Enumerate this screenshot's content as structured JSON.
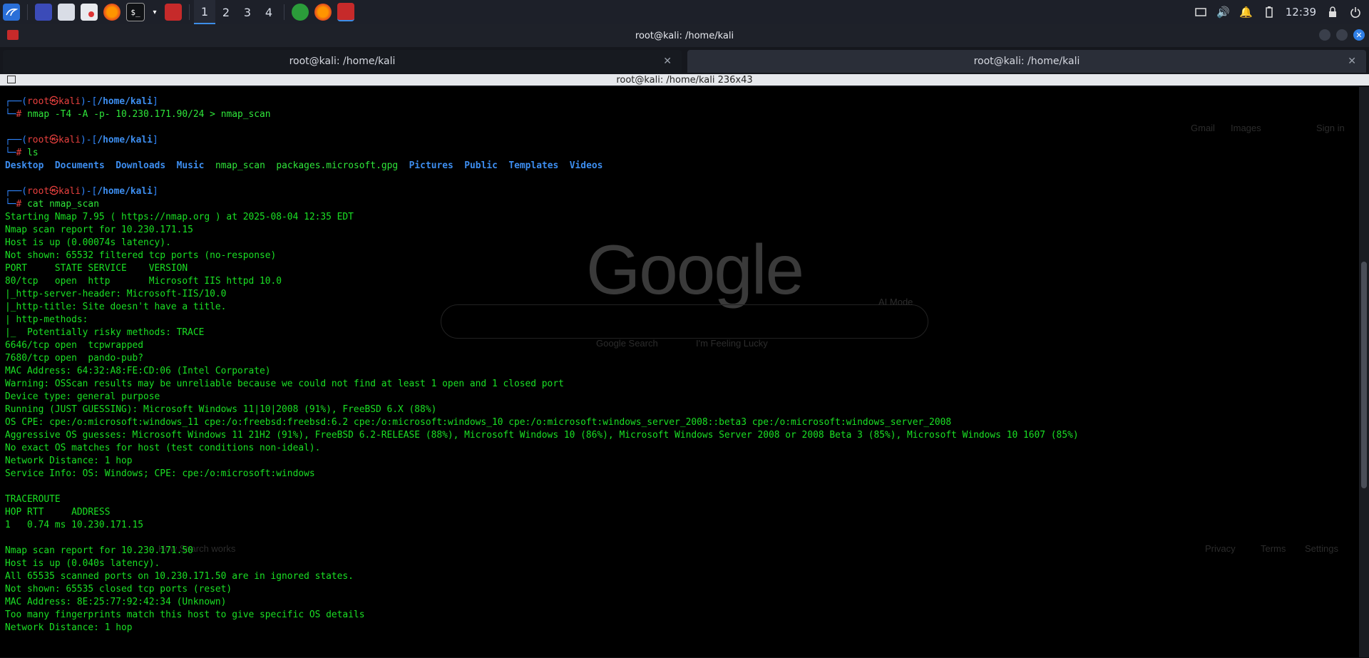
{
  "taskbar": {
    "workspaces": [
      "1",
      "2",
      "3",
      "4"
    ],
    "active_workspace": "1",
    "clock": "12:39"
  },
  "window": {
    "title": "root@kali: /home/kali",
    "tabs": [
      {
        "label": "root@kali: /home/kali",
        "active": false
      },
      {
        "label": "root@kali: /home/kali",
        "active": true
      }
    ],
    "terminal_title": "root@kali: /home/kali 236x43"
  },
  "background_page": {
    "logo": "Google",
    "links": [
      "Google Search",
      "I'm Feeling Lucky",
      "How Search works",
      "Privacy",
      "Terms",
      "Settings",
      "Gmail",
      "Images",
      "Sign in",
      "AI Mode"
    ]
  },
  "terminal": {
    "prompt": {
      "user": "root",
      "host": "kali",
      "path": "/home/kali"
    },
    "commands": [
      "nmap -T4 -A -p- 10.230.171.90/24 > nmap_scan",
      "ls",
      "cat nmap_scan"
    ],
    "ls_output": [
      "Desktop",
      "Documents",
      "Downloads",
      "Music",
      "nmap_scan",
      "packages.microsoft.gpg",
      "Pictures",
      "Public",
      "Templates",
      "Videos"
    ],
    "output": [
      "Starting Nmap 7.95 ( https://nmap.org ) at 2025-08-04 12:35 EDT",
      "Nmap scan report for 10.230.171.15",
      "Host is up (0.00074s latency).",
      "Not shown: 65532 filtered tcp ports (no-response)",
      "PORT     STATE SERVICE    VERSION",
      "80/tcp   open  http       Microsoft IIS httpd 10.0",
      "|_http-server-header: Microsoft-IIS/10.0",
      "|_http-title: Site doesn't have a title.",
      "| http-methods: ",
      "|_  Potentially risky methods: TRACE",
      "6646/tcp open  tcpwrapped",
      "7680/tcp open  pando-pub?",
      "MAC Address: 64:32:A8:FE:CD:06 (Intel Corporate)",
      "Warning: OSScan results may be unreliable because we could not find at least 1 open and 1 closed port",
      "Device type: general purpose",
      "Running (JUST GUESSING): Microsoft Windows 11|10|2008 (91%), FreeBSD 6.X (88%)",
      "OS CPE: cpe:/o:microsoft:windows_11 cpe:/o:freebsd:freebsd:6.2 cpe:/o:microsoft:windows_10 cpe:/o:microsoft:windows_server_2008::beta3 cpe:/o:microsoft:windows_server_2008",
      "Aggressive OS guesses: Microsoft Windows 11 21H2 (91%), FreeBSD 6.2-RELEASE (88%), Microsoft Windows 10 (86%), Microsoft Windows Server 2008 or 2008 Beta 3 (85%), Microsoft Windows 10 1607 (85%)",
      "No exact OS matches for host (test conditions non-ideal).",
      "Network Distance: 1 hop",
      "Service Info: OS: Windows; CPE: cpe:/o:microsoft:windows",
      "",
      "TRACEROUTE",
      "HOP RTT     ADDRESS",
      "1   0.74 ms 10.230.171.15",
      "",
      "Nmap scan report for 10.230.171.50",
      "Host is up (0.040s latency).",
      "All 65535 scanned ports on 10.230.171.50 are in ignored states.",
      "Not shown: 65535 closed tcp ports (reset)",
      "MAC Address: 8E:25:77:92:42:34 (Unknown)",
      "Too many fingerprints match this host to give specific OS details",
      "Network Distance: 1 hop"
    ]
  },
  "colors": {
    "terminal_bg": "#000000",
    "output_green": "#1ae024",
    "prompt_blue": "#2f86ff",
    "prompt_red": "#e8403e",
    "accent": "#2f7fe6"
  }
}
